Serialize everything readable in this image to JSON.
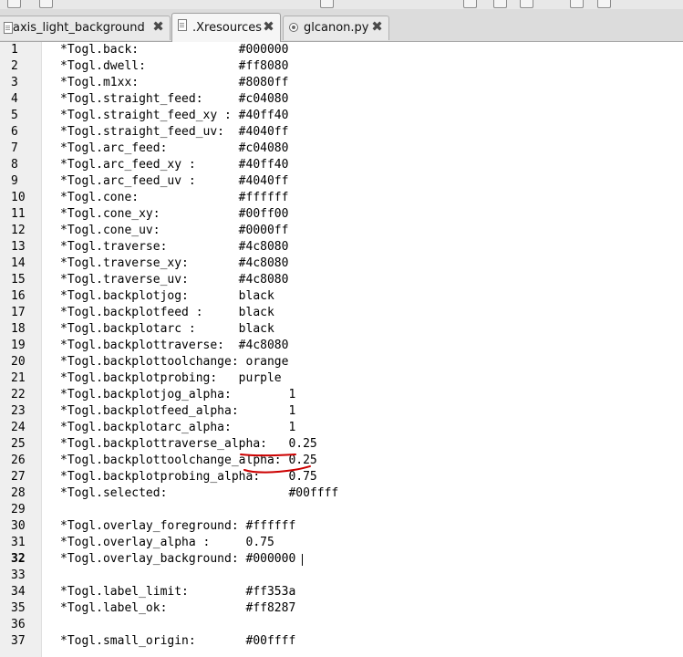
{
  "tabs": [
    {
      "name": "tab-axis-light-background",
      "label": "axis_light_background",
      "active": false,
      "icon": "document-icon"
    },
    {
      "name": "tab-xresources",
      "label": ".Xresources",
      "active": true,
      "icon": "document-icon"
    },
    {
      "name": "tab-glcanon",
      "label": "glcanon.py",
      "active": false,
      "icon": "python-file-icon"
    }
  ],
  "editor": {
    "current_line": 32,
    "lines": [
      {
        "n": "1",
        "text": "*Togl.back:              #000000"
      },
      {
        "n": "2",
        "text": "*Togl.dwell:             #ff8080"
      },
      {
        "n": "3",
        "text": "*Togl.m1xx:              #8080ff"
      },
      {
        "n": "4",
        "text": "*Togl.straight_feed:     #c04080"
      },
      {
        "n": "5",
        "text": "*Togl.straight_feed_xy : #40ff40"
      },
      {
        "n": "6",
        "text": "*Togl.straight_feed_uv:  #4040ff"
      },
      {
        "n": "7",
        "text": "*Togl.arc_feed:          #c04080"
      },
      {
        "n": "8",
        "text": "*Togl.arc_feed_xy :      #40ff40"
      },
      {
        "n": "9",
        "text": "*Togl.arc_feed_uv :      #4040ff"
      },
      {
        "n": "10",
        "text": "*Togl.cone:              #ffffff"
      },
      {
        "n": "11",
        "text": "*Togl.cone_xy:           #00ff00"
      },
      {
        "n": "12",
        "text": "*Togl.cone_uv:           #0000ff"
      },
      {
        "n": "13",
        "text": "*Togl.traverse:          #4c8080"
      },
      {
        "n": "14",
        "text": "*Togl.traverse_xy:       #4c8080"
      },
      {
        "n": "15",
        "text": "*Togl.traverse_uv:       #4c8080"
      },
      {
        "n": "16",
        "text": "*Togl.backplotjog:       black"
      },
      {
        "n": "17",
        "text": "*Togl.backplotfeed :     black"
      },
      {
        "n": "18",
        "text": "*Togl.backplotarc :      black"
      },
      {
        "n": "19",
        "text": "*Togl.backplottraverse:  #4c8080"
      },
      {
        "n": "20",
        "text": "*Togl.backplottoolchange: orange"
      },
      {
        "n": "21",
        "text": "*Togl.backplotprobing:   purple"
      },
      {
        "n": "22",
        "text": "*Togl.backplotjog_alpha:        1"
      },
      {
        "n": "23",
        "text": "*Togl.backplotfeed_alpha:       1"
      },
      {
        "n": "24",
        "text": "*Togl.backplotarc_alpha:        1"
      },
      {
        "n": "25",
        "text": "*Togl.backplottraverse_alpha:   0.25"
      },
      {
        "n": "26",
        "text": "*Togl.backplottoolchange_alpha: 0.25"
      },
      {
        "n": "27",
        "text": "*Togl.backplotprobing_alpha:    0.75"
      },
      {
        "n": "28",
        "text": "*Togl.selected:                 #00ffff"
      },
      {
        "n": "29",
        "text": ""
      },
      {
        "n": "30",
        "text": "*Togl.overlay_foreground: #ffffff"
      },
      {
        "n": "31",
        "text": "*Togl.overlay_alpha :     0.75"
      },
      {
        "n": "32",
        "text": "*Togl.overlay_background: #000000 "
      },
      {
        "n": "33",
        "text": ""
      },
      {
        "n": "34",
        "text": "*Togl.label_limit:        #ff353a"
      },
      {
        "n": "35",
        "text": "*Togl.label_ok:           #ff8287"
      },
      {
        "n": "36",
        "text": ""
      },
      {
        "n": "37",
        "text": "*Togl.small_origin:       #00ffff"
      }
    ]
  },
  "annotation": {
    "color": "#cc0000",
    "marks": [
      "red underline under \"alpha\" on lines 25 and 26"
    ]
  }
}
